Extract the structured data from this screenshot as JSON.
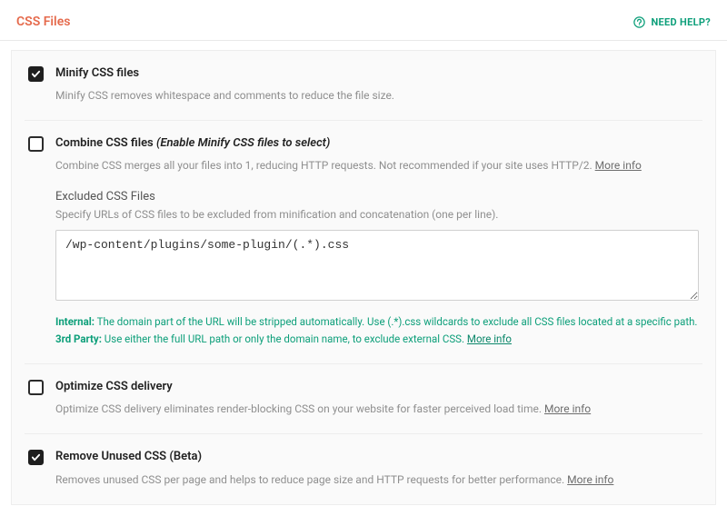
{
  "header": {
    "title": "CSS Files",
    "help": "NEED HELP?"
  },
  "more_info": "More info",
  "options": {
    "minify": {
      "label": "Minify CSS files",
      "desc": "Minify CSS removes whitespace and comments to reduce the file size."
    },
    "combine": {
      "label": "Combine CSS files ",
      "hint": "(Enable Minify CSS files to select)",
      "desc": "Combine CSS merges all your files into 1, reducing HTTP requests. Not recommended if your site uses HTTP/2. ",
      "excluded": {
        "label": "Excluded CSS Files",
        "desc": "Specify URLs of CSS files to be excluded from minification and concatenation (one per line).",
        "value": "/wp-content/plugins/some-plugin/(.*).css",
        "note_internal_l": "Internal:",
        "note_internal": " The domain part of the URL will be stripped automatically. Use (.*).css wildcards to exclude all CSS files located at a specific path.",
        "note_3p_l": "3rd Party:",
        "note_3p": " Use either the full URL path or only the domain name, to exclude external CSS. "
      }
    },
    "optimize": {
      "label": "Optimize CSS delivery",
      "desc": "Optimize CSS delivery eliminates render-blocking CSS on your website for faster perceived load time. "
    },
    "remove": {
      "label": "Remove Unused CSS (Beta)",
      "desc": "Removes unused CSS per page and helps to reduce page size and HTTP requests for better performance. "
    }
  }
}
